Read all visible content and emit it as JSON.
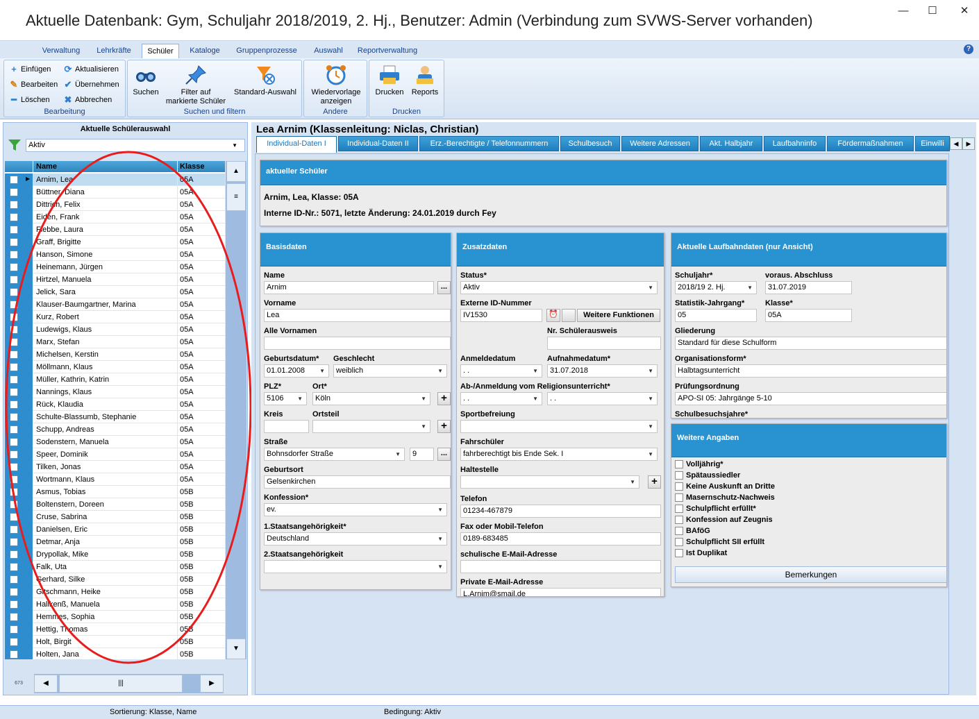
{
  "window": {
    "title": "Aktuelle Datenbank: Gym, Schuljahr 2018/2019, 2. Hj., Benutzer: Admin (Verbindung zum SVWS-Server vorhanden)",
    "minimize": "—",
    "maximize": "☐",
    "close": "✕"
  },
  "ribbon": {
    "tabs": [
      "Verwaltung",
      "Lehrkräfte",
      "Schüler",
      "Kataloge",
      "Gruppenprozesse",
      "Auswahl",
      "Reportverwaltung"
    ],
    "help": "?",
    "bearbeitung": {
      "label": "Bearbeitung",
      "einfuegen": "Einfügen",
      "aktualisieren": "Aktualisieren",
      "bearbeiten": "Bearbeiten",
      "uebernehmen": "Übernehmen",
      "loeschen": "Löschen",
      "abbrechen": "Abbrechen"
    },
    "suchen": {
      "label": "Suchen und filtern",
      "suchen": "Suchen",
      "filter1": "Filter auf",
      "filter2": "markierte Schüler",
      "standard": "Standard-Auswahl"
    },
    "andere": {
      "label": "Andere",
      "wv1": "Wiedervorlage",
      "wv2": "anzeigen"
    },
    "drucken": {
      "label": "Drucken",
      "drucken": "Drucken",
      "reports": "Reports"
    }
  },
  "left": {
    "title": "Aktuelle Schülerauswahl",
    "filter": "Aktiv",
    "col_name": "Name",
    "col_klasse": "Klasse",
    "count": "673",
    "students": [
      [
        "Arnim, Lea",
        "05A"
      ],
      [
        "Büttner, Diana",
        "05A"
      ],
      [
        "Dittrich, Felix",
        "05A"
      ],
      [
        "Eiden, Frank",
        "05A"
      ],
      [
        "Flebbe, Laura",
        "05A"
      ],
      [
        "Graff, Brigitte",
        "05A"
      ],
      [
        "Hanson, Simone",
        "05A"
      ],
      [
        "Heinemann, Jürgen",
        "05A"
      ],
      [
        "Hirtzel, Manuela",
        "05A"
      ],
      [
        "Jelick, Sara",
        "05A"
      ],
      [
        "Klauser-Baumgartner, Marina",
        "05A"
      ],
      [
        "Kurz, Robert",
        "05A"
      ],
      [
        "Ludewigs, Klaus",
        "05A"
      ],
      [
        "Marx, Stefan",
        "05A"
      ],
      [
        "Michelsen, Kerstin",
        "05A"
      ],
      [
        "Möllmann, Klaus",
        "05A"
      ],
      [
        "Müller, Kathrin, Katrin",
        "05A"
      ],
      [
        "Nannings, Klaus",
        "05A"
      ],
      [
        "Rück, Klaudia",
        "05A"
      ],
      [
        "Schulte-Blassumb, Stephanie",
        "05A"
      ],
      [
        "Schupp, Andreas",
        "05A"
      ],
      [
        "Sodenstern, Manuela",
        "05A"
      ],
      [
        "Speer, Dominik",
        "05A"
      ],
      [
        "Tilken, Jonas",
        "05A"
      ],
      [
        "Wortmann, Klaus",
        "05A"
      ],
      [
        "Asmus, Tobias",
        "05B"
      ],
      [
        "Boltenstern, Doreen",
        "05B"
      ],
      [
        "Cruse, Sabrina",
        "05B"
      ],
      [
        "Danielsen, Eric",
        "05B"
      ],
      [
        "Detmar, Anja",
        "05B"
      ],
      [
        "Drypollak, Mike",
        "05B"
      ],
      [
        "Falk, Uta",
        "05B"
      ],
      [
        "Gerhard, Silke",
        "05B"
      ],
      [
        "Gitschmann, Heike",
        "05B"
      ],
      [
        "Hallkenß, Manuela",
        "05B"
      ],
      [
        "Hemmes, Sophia",
        "05B"
      ],
      [
        "Hettig, Thomas",
        "05B"
      ],
      [
        "Holt, Birgit",
        "05B"
      ],
      [
        "Holten, Jana",
        "05B"
      ]
    ]
  },
  "main": {
    "title": "Lea Arnim (Klassenleitung: Niclas, Christian)",
    "tabs": [
      "Individual-Daten I",
      "Individual-Daten II",
      "Erz.-Berechtigte / Telefonnummern",
      "Schulbesuch",
      "Weitere Adressen",
      "Akt. Halbjahr",
      "Laufbahninfo",
      "Fördermaßnahmen",
      "Einwilli"
    ],
    "current": {
      "head": "aktueller Schüler",
      "line1": "Arnim, Lea, Klasse: 05A",
      "line2": "Interne ID-Nr.: 5071, letzte Änderung: 24.01.2019 durch Fey"
    },
    "basis": {
      "head": "Basisdaten",
      "name_l": "Name",
      "name": "Arnim",
      "vorname_l": "Vorname",
      "vorname": "Lea",
      "allev_l": "Alle Vornamen",
      "allev": "",
      "geb_l": "Geburtsdatum*",
      "geb": "01.01.2008",
      "geschl_l": "Geschlecht",
      "geschl": "weiblich",
      "plz_l": "PLZ*",
      "plz": "5106",
      "ort_l": "Ort*",
      "ort": "Köln",
      "kreis_l": "Kreis",
      "ortsteil_l": "Ortsteil",
      "strasse_l": "Straße",
      "strasse": "Bohnsdorfer Straße",
      "hausnr": "9",
      "gebort_l": "Geburtsort",
      "gebort": "Gelsenkirchen",
      "konf_l": "Konfession*",
      "konf": "ev.",
      "staat1_l": "1.Staatsangehörigkeit*",
      "staat1": "Deutschland",
      "staat2_l": "2.Staatsangehörigkeit",
      "staat2": "",
      "dots": "...",
      "plus": "+"
    },
    "zusatz": {
      "head": "Zusatzdaten",
      "status_l": "Status*",
      "status": "Aktiv",
      "extid_l": "Externe ID-Nummer",
      "extid": "IV1530",
      "weitere": "Weitere Funktionen",
      "nrsa_l": "Nr. Schülerausweis",
      "anm_l": "Anmeldedatum",
      "anm": " .  .",
      "aufn_l": "Aufnahmedatum*",
      "aufn": "31.07.2018",
      "relig_l": "Ab-/Anmeldung vom Religionsunterricht*",
      "relig1": " .  .",
      "relig2": " .  .",
      "sport_l": "Sportbefreiung",
      "fahr_l": "Fahrschüler",
      "fahr": "fahrberechtigt bis Ende Sek. I",
      "halt_l": "Haltestelle",
      "tel_l": "Telefon",
      "tel": "01234-467879",
      "fax_l": "Fax oder Mobil-Telefon",
      "fax": "0189-683485",
      "smail_l": "schulische E-Mail-Adresse",
      "pmail_l": "Private E-Mail-Adresse",
      "pmail": "L.Arnim@smail.de"
    },
    "laufbahn": {
      "head": "Aktuelle Laufbahndaten (nur Ansicht)",
      "sj_l": "Schuljahr*",
      "sj": "2018/19 2. Hj.",
      "abs_l": "voraus. Abschluss",
      "abs": "31.07.2019",
      "stat_l": "Statistik-Jahrgang*",
      "stat": "05",
      "kl_l": "Klasse*",
      "kl": "05A",
      "glied_l": "Gliederung",
      "glied": "Standard für diese Schulform",
      "orga_l": "Organisationsform*",
      "orga": "Halbtagsunterricht",
      "pruef_l": "Prüfungsordnung",
      "pruef": "APO-SI 05: Jahrgänge 5-10",
      "sbj_l": "Schulbesuchsjahre*"
    },
    "weitere": {
      "head": "Weitere Angaben",
      "items": [
        "Volljährig*",
        "Spätaussiedler",
        "Keine Auskunft an Dritte",
        "Masernschutz-Nachweis",
        "Schulpflicht erfüllt*",
        "Konfession auf Zeugnis",
        "BAföG",
        "Schulpflicht SII erfüllt",
        "Ist Duplikat"
      ],
      "bemerkungen": "Bemerkungen"
    }
  },
  "status": {
    "sort": "Sortierung: Klasse, Name",
    "cond": "Bedingung: Aktiv"
  }
}
